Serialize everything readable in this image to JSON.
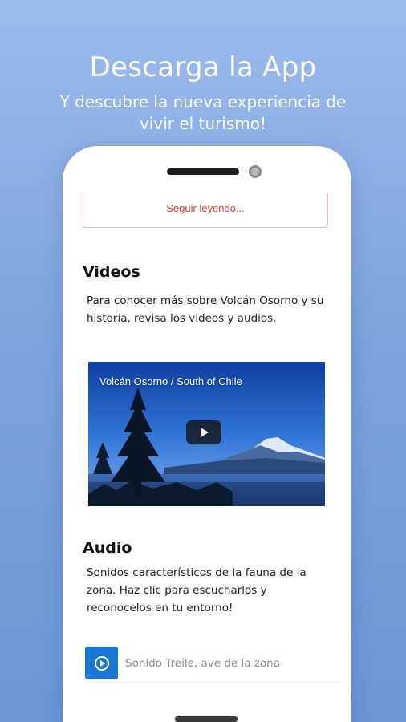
{
  "hero": {
    "title": "Descarga la App",
    "subtitle": "Y descubre la nueva experiencia de vivir el turismo!"
  },
  "content": {
    "read_more_label": "Seguir leyendo...",
    "videos": {
      "heading": "Videos",
      "description": "Para conocer más sobre Volcán Osorno y su historia, revisa los videos y audios.",
      "video_title": "Volcán Osorno / South of Chile"
    },
    "audio": {
      "heading": "Audio",
      "description": "Sonidos característicos de la fauna de la zona. Haz clic para escucharlos y reconocelos en tu entorno!",
      "items": [
        {
          "label": "Sonido Treile, ave de la zona",
          "icon": "play-circle-icon"
        }
      ]
    }
  },
  "colors": {
    "accent_red": "#e53935",
    "audio_button": "#1976d2",
    "background_top": "#9bbbec",
    "background_bottom": "#6b96d6"
  }
}
